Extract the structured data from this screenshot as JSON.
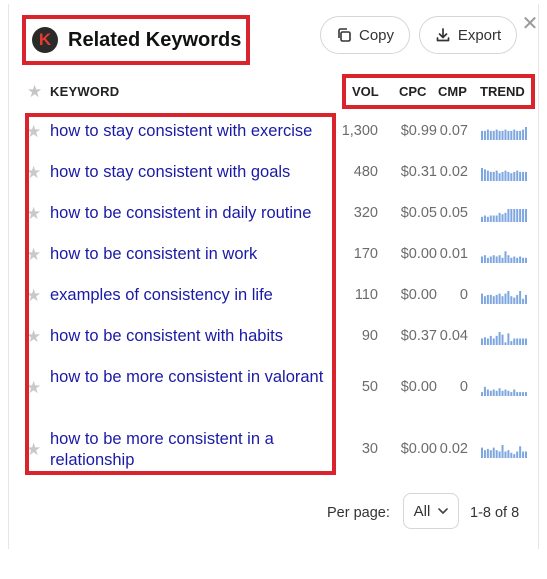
{
  "header": {
    "logo_letter": "K",
    "title": "Related Keywords",
    "copy_label": "Copy",
    "export_label": "Export",
    "close_glyph": "✕"
  },
  "columns": {
    "keyword": "KEYWORD",
    "vol": "VOL",
    "cpc": "CPC",
    "cmp": "CMP",
    "trend": "TREND"
  },
  "rows": [
    {
      "keyword": "how to stay consistent with exercise",
      "vol": "1,300",
      "cpc": "$0.99",
      "cmp": "0.07",
      "trend": [
        0.7,
        0.7,
        0.8,
        0.7,
        0.7,
        0.8,
        0.7,
        0.7,
        0.8,
        0.7,
        0.7,
        0.8,
        0.7,
        0.7,
        0.8,
        1.0
      ]
    },
    {
      "keyword": "how to stay consistent with goals",
      "vol": "480",
      "cpc": "$0.31",
      "cmp": "0.02",
      "trend": [
        1.0,
        0.9,
        0.8,
        0.7,
        0.7,
        0.8,
        0.6,
        0.7,
        0.8,
        0.7,
        0.6,
        0.7,
        0.8,
        0.7,
        0.7,
        0.7
      ]
    },
    {
      "keyword": "how to be consistent in daily routine",
      "vol": "320",
      "cpc": "$0.05",
      "cmp": "0.05",
      "trend": [
        0.4,
        0.5,
        0.4,
        0.5,
        0.5,
        0.5,
        0.7,
        0.6,
        0.7,
        1.0,
        1.0,
        1.0,
        1.0,
        1.0,
        1.0,
        1.0
      ]
    },
    {
      "keyword": "how to be consistent in work",
      "vol": "170",
      "cpc": "$0.00",
      "cmp": "0.01",
      "trend": [
        0.5,
        0.6,
        0.4,
        0.5,
        0.6,
        0.5,
        0.6,
        0.4,
        0.9,
        0.6,
        0.4,
        0.5,
        0.4,
        0.5,
        0.4,
        0.4
      ]
    },
    {
      "keyword": "examples of consistency in life",
      "vol": "110",
      "cpc": "$0.00",
      "cmp": "0",
      "trend": [
        0.8,
        0.6,
        0.7,
        0.7,
        0.6,
        0.7,
        0.8,
        0.6,
        0.8,
        1.0,
        0.6,
        0.5,
        0.7,
        1.0,
        0.4,
        0.7
      ]
    },
    {
      "keyword": "how to be consistent with habits",
      "vol": "90",
      "cpc": "$0.37",
      "cmp": "0.04",
      "trend": [
        0.5,
        0.6,
        0.5,
        0.7,
        0.5,
        0.7,
        1.0,
        0.8,
        0.2,
        0.9,
        0.3,
        0.5,
        0.5,
        0.5,
        0.5,
        0.5
      ]
    },
    {
      "keyword": "how to be more consistent in valorant",
      "vol": "50",
      "cpc": "$0.00",
      "cmp": "0",
      "trend": [
        0.3,
        0.7,
        0.5,
        0.4,
        0.5,
        0.4,
        0.6,
        0.4,
        0.5,
        0.4,
        0.3,
        0.5,
        0.3,
        0.3,
        0.3,
        0.3
      ]
    },
    {
      "keyword": "how to be more consistent in a relationship",
      "vol": "30",
      "cpc": "$0.00",
      "cmp": "0.02",
      "trend": [
        0.8,
        0.6,
        0.7,
        0.6,
        0.8,
        0.6,
        0.5,
        1.0,
        0.5,
        0.6,
        0.4,
        0.3,
        0.5,
        0.9,
        0.5,
        0.5
      ]
    }
  ],
  "footer": {
    "per_page_label": "Per page:",
    "per_page_value": "All",
    "range": "1-8 of 8"
  },
  "colors": {
    "link": "#1a1aa6",
    "highlight": "#d9232d",
    "trend_bar": "#7ea6e0"
  },
  "icons": [
    "k-logo-icon",
    "copy-icon",
    "download-icon",
    "close-icon",
    "star-icon",
    "chevron-down-icon"
  ]
}
